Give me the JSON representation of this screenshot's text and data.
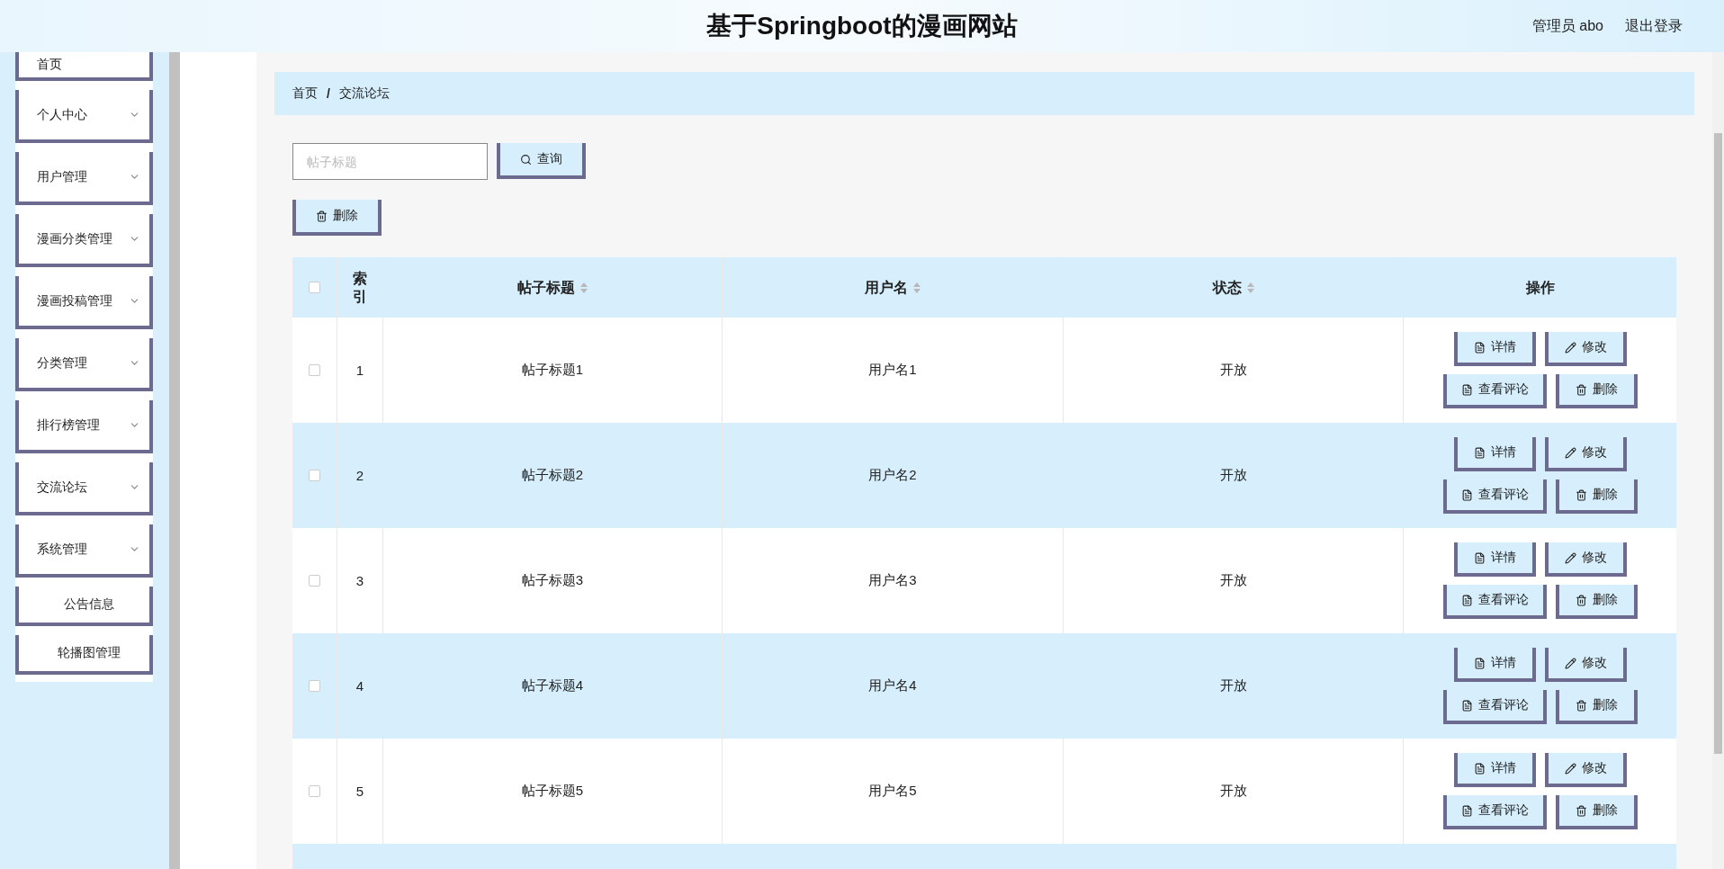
{
  "header": {
    "title": "基于Springboot的漫画网站",
    "user": "管理员 abo",
    "logout": "退出登录"
  },
  "sidebar": {
    "items": [
      {
        "label": "首页",
        "kind": "link"
      },
      {
        "label": "个人中心",
        "kind": "group"
      },
      {
        "label": "用户管理",
        "kind": "group"
      },
      {
        "label": "漫画分类管理",
        "kind": "group"
      },
      {
        "label": "漫画投稿管理",
        "kind": "group"
      },
      {
        "label": "分类管理",
        "kind": "group"
      },
      {
        "label": "排行榜管理",
        "kind": "group"
      },
      {
        "label": "交流论坛",
        "kind": "group"
      },
      {
        "label": "系统管理",
        "kind": "group",
        "children": [
          {
            "label": "公告信息"
          },
          {
            "label": "轮播图管理"
          }
        ]
      }
    ]
  },
  "breadcrumb": [
    "首页",
    "交流论坛"
  ],
  "breadcrumb_separator": "/",
  "search": {
    "placeholder": "帖子标题",
    "button": "查询"
  },
  "bulk_delete": "删除",
  "table": {
    "all_checked": false,
    "columns": [
      {
        "label": "索引",
        "sortable": false
      },
      {
        "label": "帖子标题",
        "sortable": true
      },
      {
        "label": "用户名",
        "sortable": true
      },
      {
        "label": "状态",
        "sortable": true
      },
      {
        "label": "操作",
        "sortable": false
      }
    ],
    "rows": [
      {
        "checked": false,
        "cells": [
          "1",
          "帖子标题1",
          "用户名1",
          "开放"
        ],
        "actions": [
          {
            "kind": "detail",
            "label": "详情"
          },
          {
            "kind": "edit",
            "label": "修改"
          },
          {
            "kind": "comments",
            "label": "查看评论"
          },
          {
            "kind": "delete",
            "label": "删除"
          }
        ]
      },
      {
        "checked": false,
        "cells": [
          "2",
          "帖子标题2",
          "用户名2",
          "开放"
        ],
        "actions": [
          {
            "kind": "detail",
            "label": "详情"
          },
          {
            "kind": "edit",
            "label": "修改"
          },
          {
            "kind": "comments",
            "label": "查看评论"
          },
          {
            "kind": "delete",
            "label": "删除"
          }
        ]
      },
      {
        "checked": false,
        "cells": [
          "3",
          "帖子标题3",
          "用户名3",
          "开放"
        ],
        "actions": [
          {
            "kind": "detail",
            "label": "详情"
          },
          {
            "kind": "edit",
            "label": "修改"
          },
          {
            "kind": "comments",
            "label": "查看评论"
          },
          {
            "kind": "delete",
            "label": "删除"
          }
        ]
      },
      {
        "checked": false,
        "cells": [
          "4",
          "帖子标题4",
          "用户名4",
          "开放"
        ],
        "actions": [
          {
            "kind": "detail",
            "label": "详情"
          },
          {
            "kind": "edit",
            "label": "修改"
          },
          {
            "kind": "comments",
            "label": "查看评论"
          },
          {
            "kind": "delete",
            "label": "删除"
          }
        ]
      },
      {
        "checked": false,
        "cells": [
          "5",
          "帖子标题5",
          "用户名5",
          "开放"
        ],
        "actions": [
          {
            "kind": "detail",
            "label": "详情"
          },
          {
            "kind": "edit",
            "label": "修改"
          },
          {
            "kind": "comments",
            "label": "查看评论"
          },
          {
            "kind": "delete",
            "label": "删除"
          }
        ]
      }
    ]
  }
}
